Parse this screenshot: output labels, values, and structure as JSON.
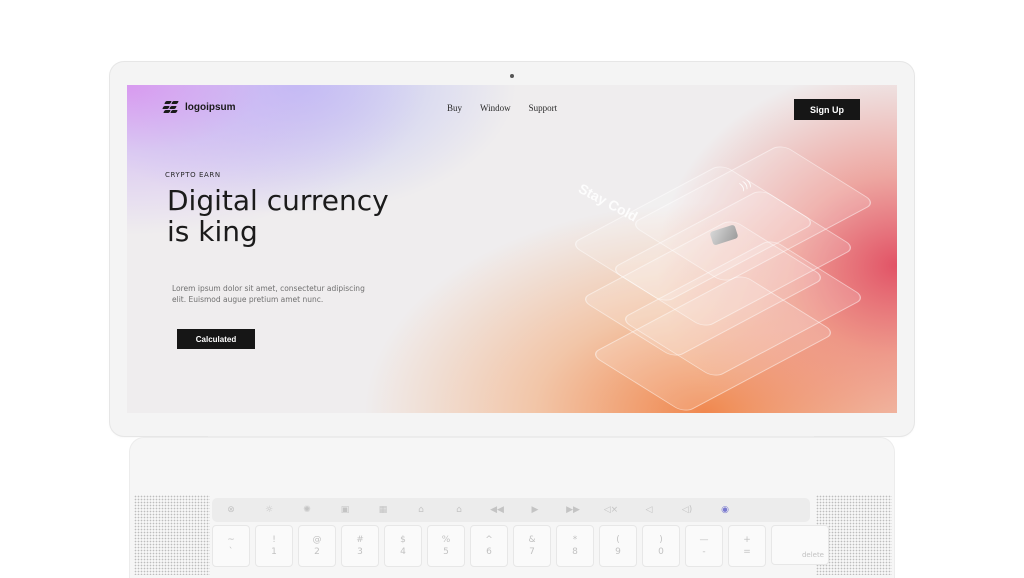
{
  "site": {
    "logo_text": "logoipsum",
    "logo_mark_icon": "logo-mark-icon"
  },
  "nav": {
    "items": [
      {
        "label": "Buy"
      },
      {
        "label": "Window"
      },
      {
        "label": "Support"
      }
    ]
  },
  "header": {
    "signup_label": "Sign Up"
  },
  "hero": {
    "eyebrow": "CRYPTO EARN",
    "headline": "Digital currency is king",
    "body": "Lorem ipsum dolor sit amet, consectetur adipiscing elit. Euismod augue pretium amet nunc.",
    "cta_label": "Calculated",
    "card_text": "Stay Cold"
  },
  "colors": {
    "accent_dark": "#161616",
    "gradient_purple": "#d796f0",
    "gradient_red": "#e14b5f",
    "gradient_orange": "#f08246"
  },
  "keyboard": {
    "touchbar_icons": [
      "escape-icon",
      "brightness-down-icon",
      "brightness-up-icon",
      "mission-control-icon",
      "launchpad-icon",
      "keyboard-light-down-icon",
      "keyboard-light-up-icon",
      "rewind-icon",
      "play-icon",
      "fast-forward-icon",
      "mute-icon",
      "volume-down-icon",
      "volume-up-icon",
      "siri-icon"
    ],
    "keys": [
      {
        "top": "~",
        "bottom": "`"
      },
      {
        "top": "!",
        "bottom": "1"
      },
      {
        "top": "@",
        "bottom": "2"
      },
      {
        "top": "#",
        "bottom": "3"
      },
      {
        "top": "$",
        "bottom": "4"
      },
      {
        "top": "%",
        "bottom": "5"
      },
      {
        "top": "^",
        "bottom": "6"
      },
      {
        "top": "&",
        "bottom": "7"
      },
      {
        "top": "*",
        "bottom": "8"
      },
      {
        "top": "(",
        "bottom": "9"
      },
      {
        "top": ")",
        "bottom": "0"
      },
      {
        "top": "—",
        "bottom": "-"
      },
      {
        "top": "+",
        "bottom": "="
      }
    ],
    "delete_label": "delete"
  }
}
